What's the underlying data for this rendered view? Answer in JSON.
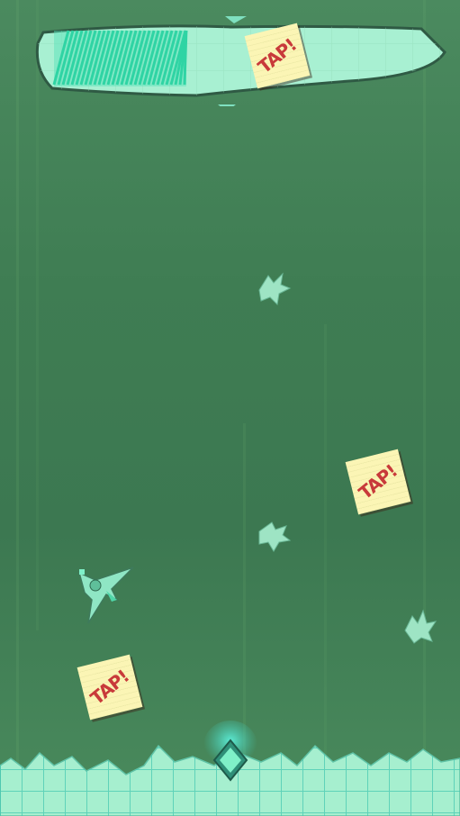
{
  "game": {
    "progress_fraction": 0.36,
    "tap_notes": [
      {
        "label": "TAP!"
      },
      {
        "label": "TAP!"
      },
      {
        "label": "TAP!"
      }
    ],
    "colors": {
      "background": "#3f7d53",
      "accent": "#7ff0c8",
      "note_paper": "#fbf5b5",
      "note_ink": "#c83a3a",
      "scribble": "#2fd4a4"
    },
    "icons": [
      "ship-icon",
      "crystal-fragment-icon",
      "diamond-gem-icon"
    ]
  }
}
